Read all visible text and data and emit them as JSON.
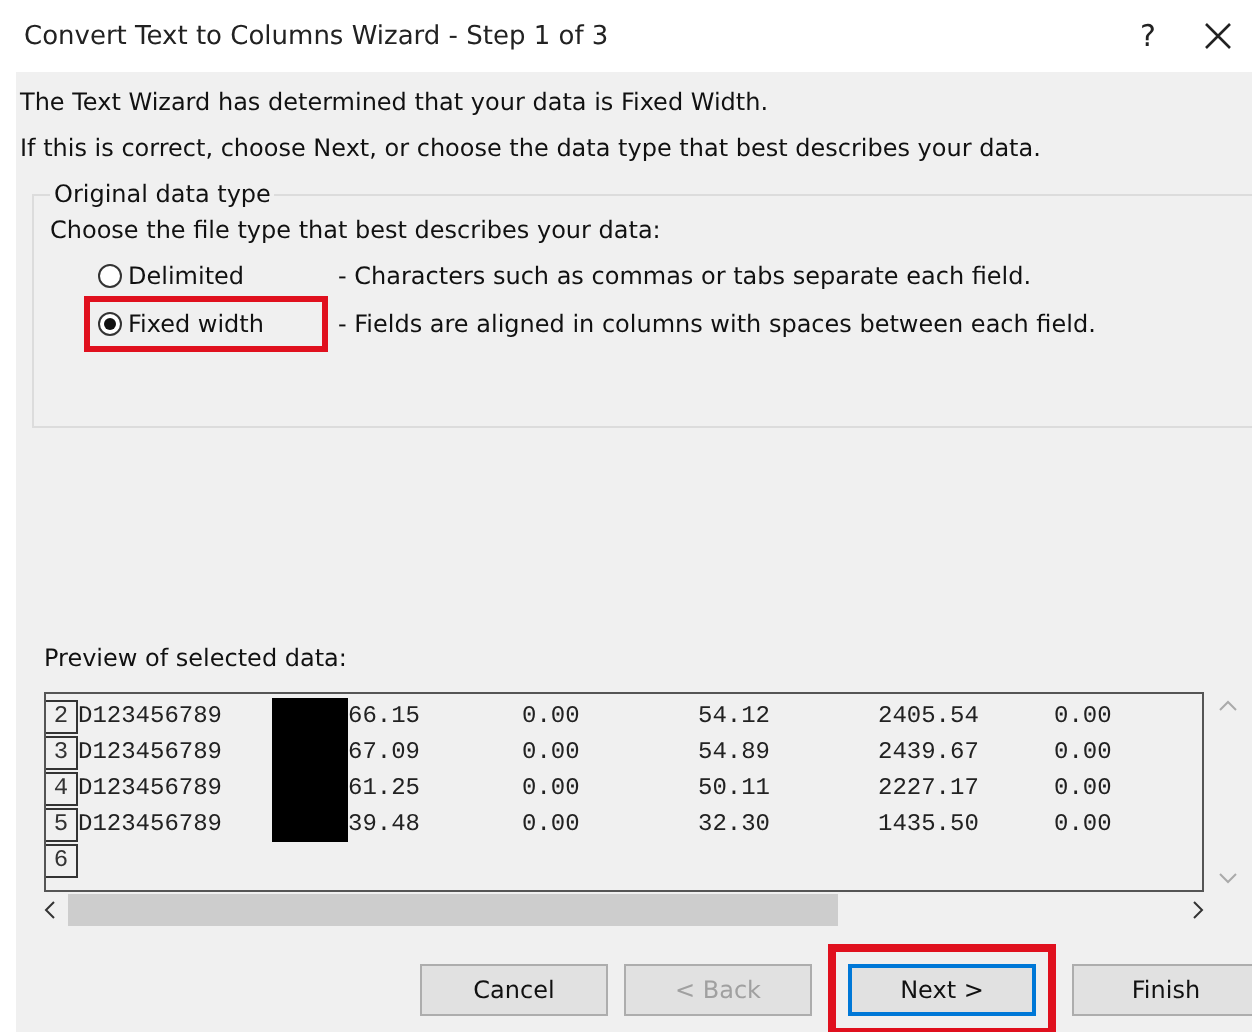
{
  "window": {
    "title": "Convert Text to Columns Wizard - Step 1 of 3",
    "help": "?"
  },
  "intro": [
    "The Text Wizard has determined that your data is Fixed Width.",
    "If this is correct, choose Next, or choose the data type that best describes your data."
  ],
  "data_type": {
    "legend": "Original data type",
    "prompt": "Choose the file type that best describes your data:",
    "options": [
      {
        "label": "Delimited",
        "description": "- Characters such as commas or tabs separate each field.",
        "selected": false,
        "highlighted": false
      },
      {
        "label": "Fixed width",
        "description": "- Fields are aligned in columns with spaces between each field.",
        "selected": true,
        "highlighted": true
      }
    ]
  },
  "preview": {
    "label": "Preview of selected data:",
    "rows": [
      {
        "number": "2",
        "cells": [
          "D123456789",
          "66.15",
          "0.00",
          "54.12",
          "2405.54",
          "0.00"
        ]
      },
      {
        "number": "3",
        "cells": [
          "D123456789",
          "67.09",
          "0.00",
          "54.89",
          "2439.67",
          "0.00"
        ]
      },
      {
        "number": "4",
        "cells": [
          "D123456789",
          "61.25",
          "0.00",
          "50.11",
          "2227.17",
          "0.00"
        ]
      },
      {
        "number": "5",
        "cells": [
          "D123456789",
          "39.48",
          "0.00",
          "32.30",
          "1435.50",
          "0.00"
        ]
      },
      {
        "number": "6",
        "cells": []
      }
    ]
  },
  "buttons": [
    {
      "label": "Cancel",
      "disabled": false,
      "default": false,
      "highlighted": false
    },
    {
      "label": "< Back",
      "disabled": true,
      "default": false,
      "highlighted": false
    },
    {
      "label": "Next >",
      "disabled": false,
      "default": true,
      "highlighted": true
    },
    {
      "label": "Finish",
      "disabled": false,
      "default": false,
      "highlighted": false
    }
  ]
}
